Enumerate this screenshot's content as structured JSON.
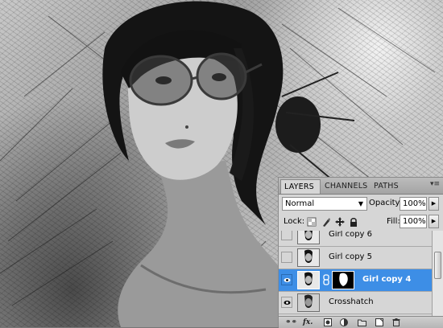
{
  "layers_panel": {
    "tabs": [
      "LAYERS",
      "CHANNELS",
      "PATHS"
    ],
    "active_tab": "LAYERS",
    "blend_mode": "Normal",
    "opacity_label": "Opacity:",
    "opacity_value": "100%",
    "lock_label": "Lock:",
    "fill_label": "Fill:",
    "fill_value": "100%",
    "layers": [
      {
        "name": "Girl copy 6",
        "visible": false,
        "selected": false,
        "has_mask": false
      },
      {
        "name": "Girl copy 5",
        "visible": false,
        "selected": false,
        "has_mask": false
      },
      {
        "name": "Girl copy 4",
        "visible": true,
        "selected": true,
        "has_mask": true
      },
      {
        "name": "Crosshatch",
        "visible": true,
        "selected": false,
        "has_mask": false
      }
    ],
    "bottom_icons": [
      "link-layers-icon",
      "fx-icon",
      "add-mask-icon",
      "adjustment-layer-icon",
      "new-group-icon",
      "new-layer-icon",
      "trash-icon"
    ],
    "fx_label": "fx."
  },
  "colors": {
    "selection": "#3d8ee6",
    "panel_bg": "#d6d6d6"
  }
}
